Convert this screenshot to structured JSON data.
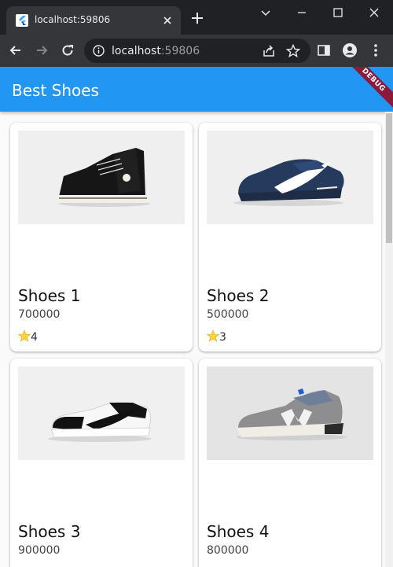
{
  "browser": {
    "tab_title": "localhost:59806",
    "url_host": "localhost",
    "url_port": ":59806"
  },
  "app": {
    "title": "Best Shoes",
    "debug_label": "DEBUG",
    "accent_color": "#2196f3"
  },
  "products": [
    {
      "name": "Shoes 1",
      "price": "700000",
      "rating": "4",
      "image": "black-high-top-sneaker"
    },
    {
      "name": "Shoes 2",
      "price": "500000",
      "rating": "3",
      "image": "navy-runner-sneaker"
    },
    {
      "name": "Shoes 3",
      "price": "900000",
      "rating": "",
      "image": "black-white-low-sneaker"
    },
    {
      "name": "Shoes 4",
      "price": "800000",
      "rating": "",
      "image": "grey-suede-runner"
    }
  ]
}
